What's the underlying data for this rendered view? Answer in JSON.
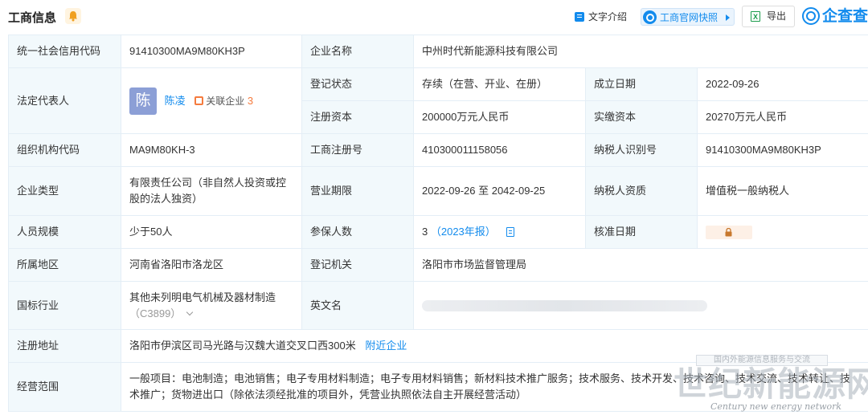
{
  "header": {
    "title": "工商信息",
    "text_intro": "文字介绍",
    "snapshot": "工商官网快照",
    "export": "导出",
    "brand": "企查查"
  },
  "rows": {
    "credit_code_label": "统一社会信用代码",
    "credit_code": "91410300MA9M80KH3P",
    "company_name_label": "企业名称",
    "company_name": "中州时代新能源科技有限公司",
    "legal_rep_label": "法定代表人",
    "legal_rep_avatar": "陈",
    "legal_rep_name": "陈凌",
    "related_label": "关联企业",
    "related_count": "3",
    "reg_status_label": "登记状态",
    "reg_status": "存续（在营、开业、在册）",
    "founded_label": "成立日期",
    "founded": "2022-09-26",
    "reg_capital_label": "注册资本",
    "reg_capital": "200000万元人民币",
    "paid_capital_label": "实缴资本",
    "paid_capital": "20270万元人民币",
    "org_code_label": "组织机构代码",
    "org_code": "MA9M80KH-3",
    "biz_reg_no_label": "工商注册号",
    "biz_reg_no": "410300011158056",
    "taxpayer_id_label": "纳税人识别号",
    "taxpayer_id": "91410300MA9M80KH3P",
    "company_type_label": "企业类型",
    "company_type": "有限责任公司（非自然人投资或控股的法人独资）",
    "term_label": "营业期限",
    "term": "2022-09-26 至 2042-09-25",
    "taxpayer_qual_label": "纳税人资质",
    "taxpayer_qual": "增值税一般纳税人",
    "staff_label": "人员规模",
    "staff": "少于50人",
    "insured_label": "参保人数",
    "insured": "3",
    "insured_report": "（2023年报）",
    "approval_date_label": "核准日期",
    "region_label": "所属地区",
    "region": "河南省洛阳市洛龙区",
    "reg_authority_label": "登记机关",
    "reg_authority": "洛阳市市场监督管理局",
    "industry_label": "国标行业",
    "industry": "其他未列明电气机械及器材制造",
    "industry_code": "（C3899）",
    "english_name_label": "英文名",
    "address_label": "注册地址",
    "address": "洛阳市伊滨区司马光路与汉魏大道交叉口西300米",
    "nearby": "附近企业",
    "scope_label": "经营范围",
    "scope": "一般项目：电池制造；电池销售；电子专用材料制造；电子专用材料销售；新材料技术推广服务；技术服务、技术开发、技术咨询、技术交流、技术转让、技术推广；货物进出口（除依法须经批准的项目外，凭营业执照依法自主开展经营活动）"
  },
  "watermark": {
    "box_text": "国内外能源信息服务与交流",
    "main": "世纪新能源网",
    "sub": "Century new energy network"
  },
  "colors": {
    "accent": "#128bed",
    "label_bg": "#f2f9fc",
    "border": "#e4eef6",
    "related": "#f57b3e"
  }
}
